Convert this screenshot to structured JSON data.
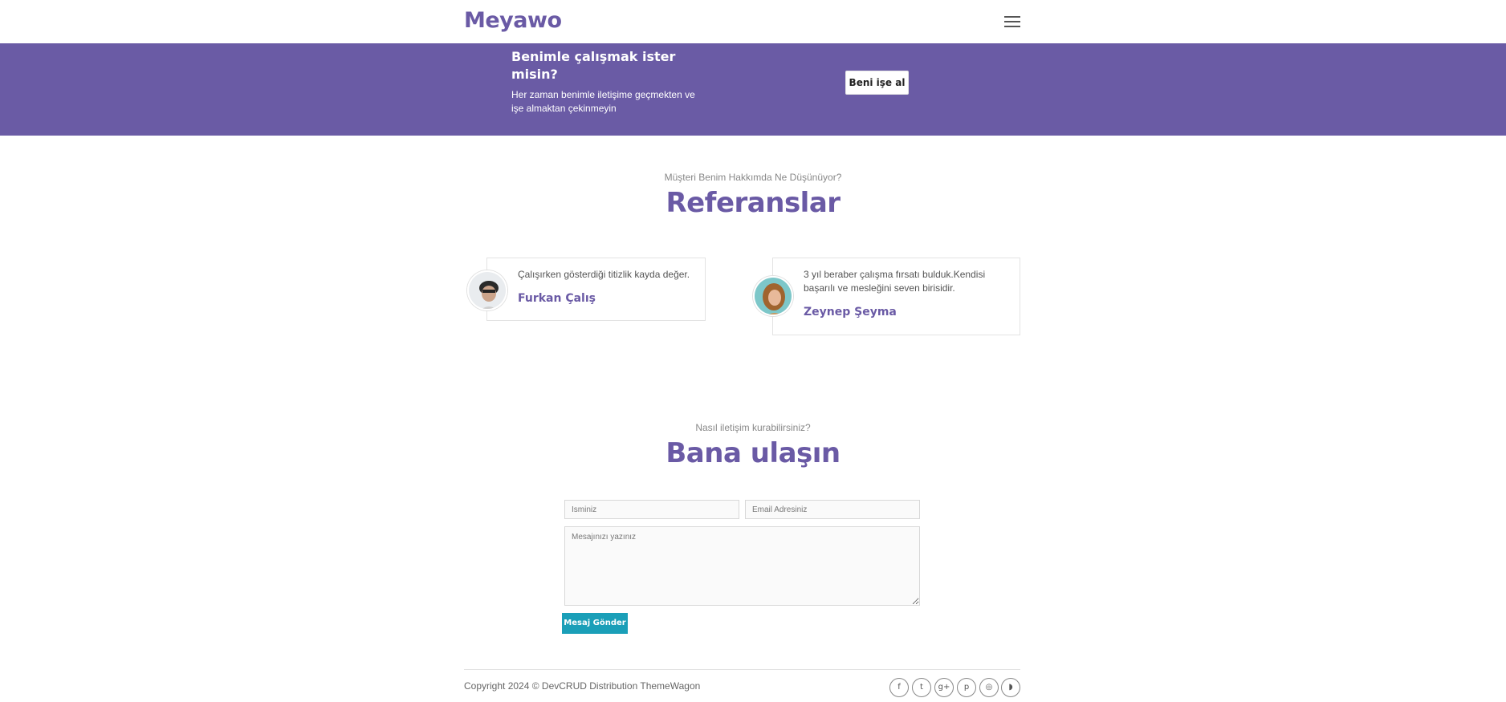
{
  "navbar": {
    "brand": "Meyawo",
    "menu_icon": "hamburger-icon"
  },
  "hire": {
    "title": "Benimle çalışmak ister misin?",
    "text": "Her zaman benimle iletişime geçmekten ve işe almaktan çekinmeyin",
    "button_label": "Beni işe al",
    "background": "#6a5ba5"
  },
  "testimonials": {
    "subtitle": "Müşteri Benim Hakkımda Ne Düşünüyor?",
    "title": "Referanslar",
    "items": [
      {
        "text": "Çalışırken gösterdiği titizlik kayda değer.",
        "name": "Furkan Çalış",
        "avatar": "man-avatar"
      },
      {
        "text": "3 yıl beraber çalışma fırsatı bulduk.Kendisi başarılı ve mesleğini seven birisidir.",
        "name": "Zeynep Şeyma",
        "avatar": "woman-avatar"
      }
    ]
  },
  "contact": {
    "subtitle": "Nasıl iletişim kurabilirsiniz?",
    "title": "Bana ulaşın",
    "name_placeholder": "İsminiz",
    "email_placeholder": "Email Adresiniz",
    "message_placeholder": "Mesajınızı yazınız",
    "send_label": "Mesaj Gönder",
    "button_color": "#1a9fb8"
  },
  "footer": {
    "copyright": "Copyright 2024 © DevCRUD Distribution ThemeWagon",
    "social": [
      {
        "icon": "facebook-icon",
        "glyph": "f"
      },
      {
        "icon": "twitter-icon",
        "glyph": "t"
      },
      {
        "icon": "google-plus-icon",
        "glyph": "g+"
      },
      {
        "icon": "pinterest-icon",
        "glyph": "p"
      },
      {
        "icon": "instagram-icon",
        "glyph": "◎"
      },
      {
        "icon": "rss-icon",
        "glyph": "◗"
      }
    ]
  },
  "colors": {
    "accent": "#6a5aa5",
    "text": "#555555"
  }
}
